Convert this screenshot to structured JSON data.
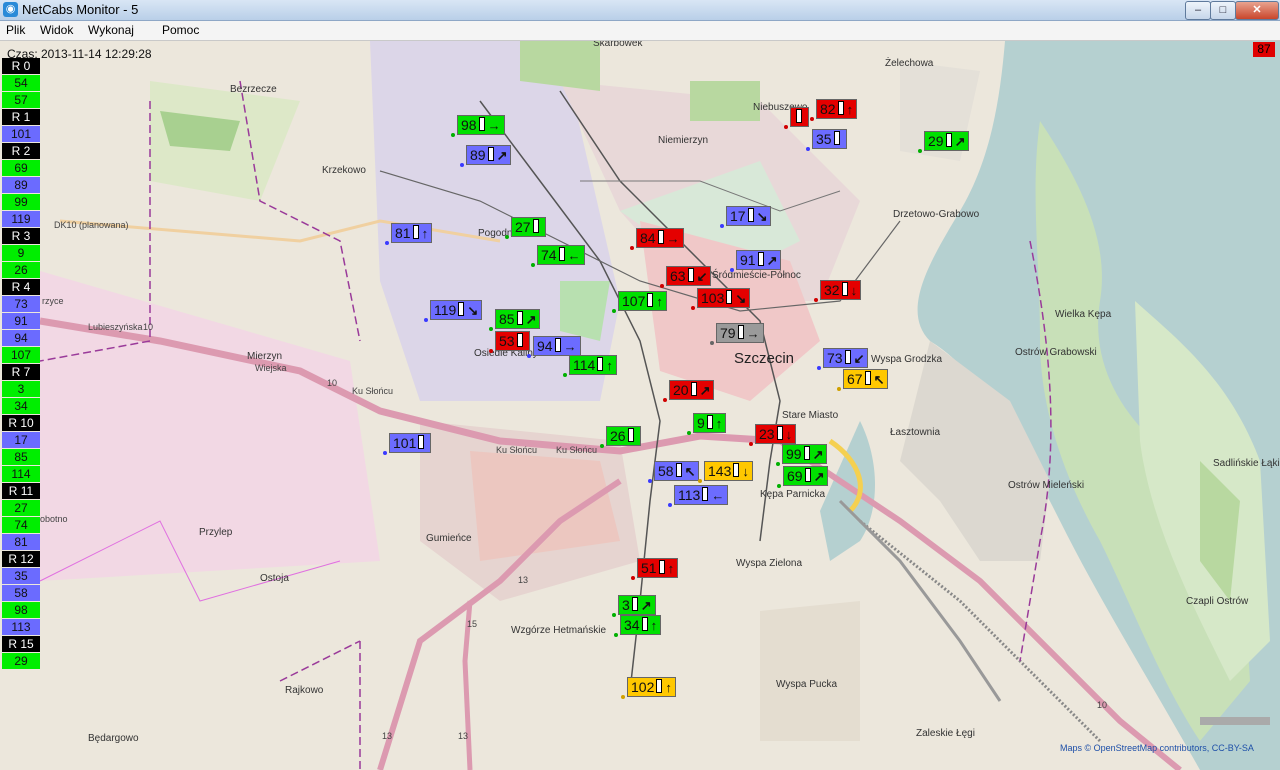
{
  "window": {
    "title": "NetCabs Monitor - 5",
    "icon": "eye-icon",
    "minimize": "–",
    "maximize": "□",
    "close": "✕"
  },
  "menu": [
    "Plik",
    "Widok",
    "Wykonaj",
    "Pomoc"
  ],
  "map": {
    "time": "Czas: 2013-11-14 12:29:28",
    "counter": "87",
    "attribution": "Maps © OpenStreetMap contributors, CC-BY-SA",
    "labels": {
      "skarbowek": "Skarbowek",
      "zelechowa": "Żelechowa",
      "bezrzecze": "Bezrzecze",
      "niebuszewo": "Niebuszewo",
      "niemierzyn": "Niemierzyn",
      "krzekowo": "Krzekowo",
      "drzetowo": "Drzetowo-Grabowo",
      "dk10": "DK10 (planowana)",
      "pogodno": "Pogodno",
      "srodmiescie": "Śródmieście-Północ",
      "wielka_kepa": "Wielka Kępa",
      "osiedle": "Osiedle Kaliny",
      "szczecin": "Szczecin",
      "ostrow_grabowski": "Ostrów Grabowski",
      "wyspa_grodzka": "Wyspa Grodzka",
      "mierzyn": "Mierzyn",
      "stare_miasto": "Stare Miasto",
      "lasztownia": "Łasztownia",
      "sadlinskie": "Sadlińskie Łąki",
      "ostrow_mielenski": "Ostrów Mieleński",
      "kepa_parnicka": "Kępa Parnicka",
      "przylep": "Przylep",
      "gumience": "Gumieńce",
      "wyspa_zielona": "Wyspa Zielona",
      "ostoja": "Ostoja",
      "czapli_ostrow": "Czapli Ostrów",
      "wzgorze": "Wzgórze Hetmańskie",
      "rajkowo": "Rajkowo",
      "wyspa_pucka": "Wyspa Pucka",
      "bedargowo": "Będargowo",
      "zaleskie": "Zaleskie Łęgi",
      "lubieszynska": "Lubieszyńska",
      "ku_sloncu": "Ku Słońcu",
      "ku_sloncu2": "Ku Słońcu",
      "ku_sloncu3": "Ku Słońcu",
      "rw10": "10",
      "rw10b": "10",
      "rw10c": "10",
      "rw13": "13",
      "rw13b": "13",
      "rw13c": "13",
      "rw15": "15",
      "obotno": "obotno",
      "izyce": "rzyce",
      "wiejska": "Wiejska"
    }
  },
  "sidebar": [
    {
      "text": "R 0",
      "kind": "hdr"
    },
    {
      "text": "54",
      "kind": "green"
    },
    {
      "text": "57",
      "kind": "green"
    },
    {
      "text": "R 1",
      "kind": "hdr"
    },
    {
      "text": "101",
      "kind": "blue"
    },
    {
      "text": "R 2",
      "kind": "hdr"
    },
    {
      "text": "69",
      "kind": "green"
    },
    {
      "text": "89",
      "kind": "blue"
    },
    {
      "text": "99",
      "kind": "green"
    },
    {
      "text": "119",
      "kind": "blue"
    },
    {
      "text": "R 3",
      "kind": "hdr"
    },
    {
      "text": "9",
      "kind": "green"
    },
    {
      "text": "26",
      "kind": "green"
    },
    {
      "text": "R 4",
      "kind": "hdr"
    },
    {
      "text": "73",
      "kind": "blue"
    },
    {
      "text": "91",
      "kind": "blue"
    },
    {
      "text": "94",
      "kind": "blue"
    },
    {
      "text": "107",
      "kind": "green"
    },
    {
      "text": "R 7",
      "kind": "hdr"
    },
    {
      "text": "3",
      "kind": "green"
    },
    {
      "text": "34",
      "kind": "green"
    },
    {
      "text": "R 10",
      "kind": "hdr"
    },
    {
      "text": "17",
      "kind": "blue"
    },
    {
      "text": "85",
      "kind": "green"
    },
    {
      "text": "114",
      "kind": "green"
    },
    {
      "text": "R 11",
      "kind": "hdr"
    },
    {
      "text": "27",
      "kind": "green"
    },
    {
      "text": "74",
      "kind": "green"
    },
    {
      "text": "81",
      "kind": "blue"
    },
    {
      "text": "R 12",
      "kind": "hdr"
    },
    {
      "text": "35",
      "kind": "blue"
    },
    {
      "text": "58",
      "kind": "blue"
    },
    {
      "text": "98",
      "kind": "green"
    },
    {
      "text": "113",
      "kind": "blue"
    },
    {
      "text": "R 15",
      "kind": "hdr"
    },
    {
      "text": "29",
      "kind": "green"
    }
  ],
  "cabs": [
    {
      "num": "98",
      "color": "green",
      "arrow": "→"
    },
    {
      "num": "82",
      "color": "red",
      "arrow": "↑"
    },
    {
      "num": "",
      "color": "red",
      "arrow": ""
    },
    {
      "num": "35",
      "color": "blue",
      "arrow": ""
    },
    {
      "num": "29",
      "color": "green",
      "arrow": "↗"
    },
    {
      "num": "89",
      "color": "blue",
      "arrow": "↗"
    },
    {
      "num": "17",
      "color": "blue",
      "arrow": "↘"
    },
    {
      "num": "27",
      "color": "green",
      "arrow": ""
    },
    {
      "num": "81",
      "color": "blue",
      "arrow": "↑"
    },
    {
      "num": "84",
      "color": "red",
      "arrow": "→"
    },
    {
      "num": "74",
      "color": "green",
      "arrow": "←"
    },
    {
      "num": "91",
      "color": "blue",
      "arrow": "↗"
    },
    {
      "num": "63",
      "color": "red",
      "arrow": "↙"
    },
    {
      "num": "32",
      "color": "red",
      "arrow": "↓"
    },
    {
      "num": "103",
      "color": "red",
      "arrow": "↘"
    },
    {
      "num": "107",
      "color": "green",
      "arrow": "↑"
    },
    {
      "num": "119",
      "color": "blue",
      "arrow": "↘"
    },
    {
      "num": "85",
      "color": "green",
      "arrow": "↗"
    },
    {
      "num": "79",
      "color": "grey",
      "arrow": "→"
    },
    {
      "num": "53",
      "color": "red",
      "arrow": ""
    },
    {
      "num": "94",
      "color": "blue",
      "arrow": "→"
    },
    {
      "num": "73",
      "color": "blue",
      "arrow": "↙"
    },
    {
      "num": "114",
      "color": "green",
      "arrow": "↑"
    },
    {
      "num": "67",
      "color": "yellow",
      "arrow": "↖"
    },
    {
      "num": "20",
      "color": "red",
      "arrow": "↗"
    },
    {
      "num": "9",
      "color": "green",
      "arrow": "↑"
    },
    {
      "num": "101",
      "color": "blue",
      "arrow": ""
    },
    {
      "num": "23",
      "color": "red",
      "arrow": "↓"
    },
    {
      "num": "26",
      "color": "green",
      "arrow": ""
    },
    {
      "num": "99",
      "color": "green",
      "arrow": "↗"
    },
    {
      "num": "58",
      "color": "blue",
      "arrow": "↖"
    },
    {
      "num": "143",
      "color": "yellow",
      "arrow": "↓"
    },
    {
      "num": "69",
      "color": "green",
      "arrow": "↗"
    },
    {
      "num": "113",
      "color": "blue",
      "arrow": "←"
    },
    {
      "num": "51",
      "color": "red",
      "arrow": "↑"
    },
    {
      "num": "3",
      "color": "green",
      "arrow": "↗"
    },
    {
      "num": "34",
      "color": "green",
      "arrow": "↑"
    },
    {
      "num": "102",
      "color": "yellow",
      "arrow": "↑"
    }
  ]
}
